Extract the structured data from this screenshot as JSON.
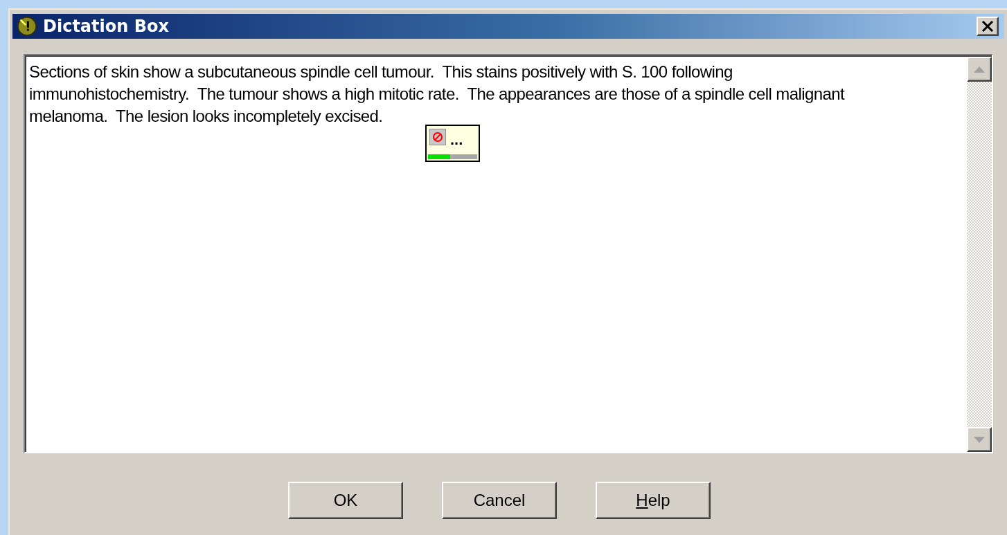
{
  "window": {
    "title": "Dictation Box"
  },
  "text_lines": [
    "Sections of skin show a subcutaneous spindle cell tumour.  This stains positively with S. 100 following",
    "immunohistochemistry.  The tumour shows a high mitotic rate.  The appearances are those of a spindle cell malignant",
    "melanoma.  The lesion looks incompletely excised."
  ],
  "status_popup": {
    "text": "...",
    "level": 0.45
  },
  "buttons": [
    {
      "label": "OK",
      "mnemonic_underlined": false
    },
    {
      "label": "Cancel",
      "mnemonic_underlined": false
    },
    {
      "label": "Help",
      "mnemonic_underlined": true
    }
  ]
}
